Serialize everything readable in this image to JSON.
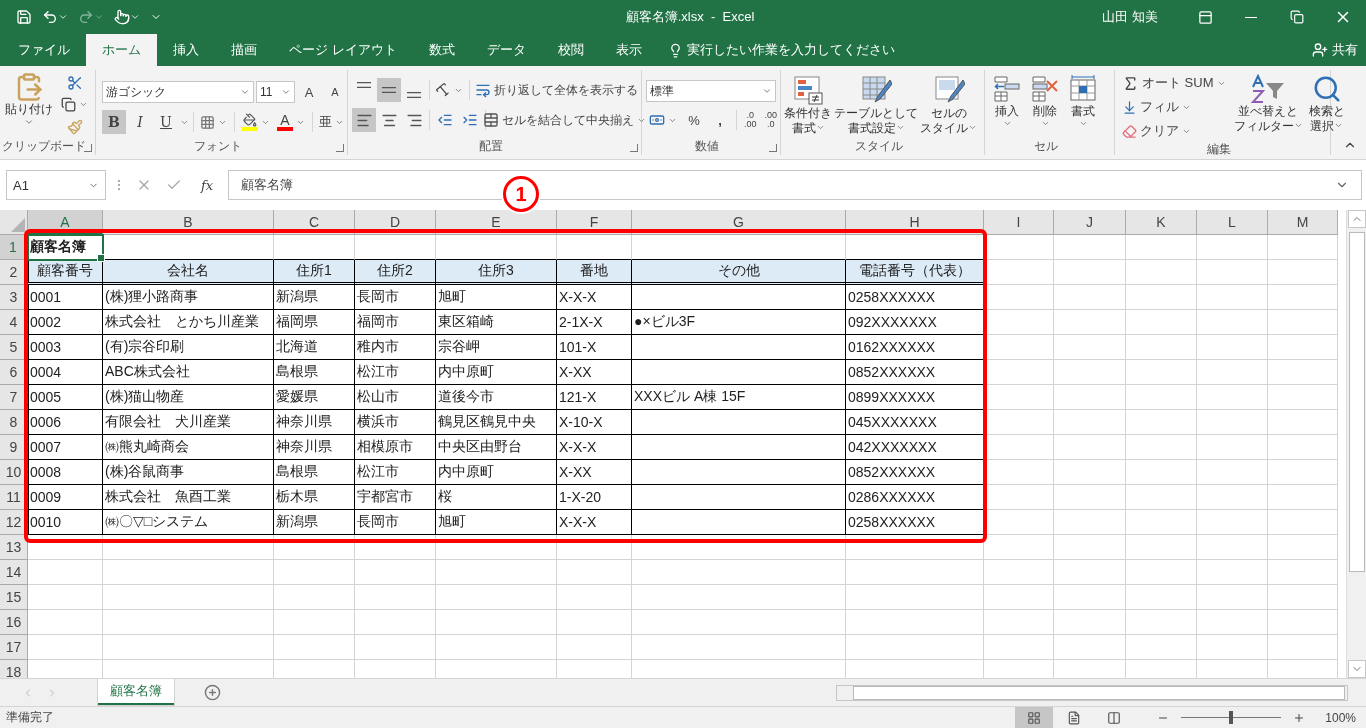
{
  "window": {
    "title": "顧客名簿.xlsx  -  Excel",
    "user": "山田 知美"
  },
  "tabs": [
    {
      "label": "ファイル",
      "selected": false
    },
    {
      "label": "ホーム",
      "selected": true
    },
    {
      "label": "挿入",
      "selected": false
    },
    {
      "label": "描画",
      "selected": false
    },
    {
      "label": "ページ レイアウト",
      "selected": false
    },
    {
      "label": "数式",
      "selected": false
    },
    {
      "label": "データ",
      "selected": false
    },
    {
      "label": "校閲",
      "selected": false
    },
    {
      "label": "表示",
      "selected": false
    }
  ],
  "tell_me": "実行したい作業を入力してください",
  "share": "共有",
  "clipboard": {
    "label": "クリップボード",
    "paste": "貼り付け"
  },
  "font": {
    "label": "フォント",
    "name": "游ゴシック",
    "size": "11",
    "grow": "A",
    "shrink": "A",
    "styles": [
      {
        "kind": "bold",
        "label": "B",
        "selected": true
      },
      {
        "kind": "italic",
        "label": "I",
        "selected": false
      },
      {
        "kind": "underline",
        "label": "U",
        "selected": false
      }
    ],
    "font_color_label": "A",
    "phonetic": "亜"
  },
  "alignment": {
    "label": "配置",
    "vertical": [
      {
        "kind": "top",
        "selected": false
      },
      {
        "kind": "middle",
        "selected": true
      },
      {
        "kind": "bottom",
        "selected": false
      }
    ],
    "horizontal": [
      {
        "kind": "left",
        "selected": true
      },
      {
        "kind": "center",
        "selected": false
      },
      {
        "kind": "right",
        "selected": false
      }
    ],
    "wrap": "折り返して全体を表示する",
    "merge": "セルを結合して中央揃え"
  },
  "number": {
    "label": "数値",
    "format": "標準",
    "percent": "%",
    "comma": ",",
    "decimals": [
      {
        "top": ".0",
        "bottom": ".00"
      },
      {
        "top": ".00",
        "bottom": ".0"
      }
    ]
  },
  "styles": {
    "label": "スタイル",
    "buttons": [
      "条件付き書式",
      "テーブルとして書式設定",
      "セルのスタイル"
    ]
  },
  "cells": {
    "label": "セル",
    "buttons": [
      "挿入",
      "削除",
      "書式"
    ]
  },
  "editing": {
    "label": "編集",
    "autosum": "オート SUM",
    "fill": "フィル",
    "clear": "クリア",
    "sort": "並べ替えとフィルター",
    "find": "検索と選択"
  },
  "formula_bar": {
    "name_box": "A1",
    "fx": "fx",
    "value": "顧客名簿"
  },
  "sheet": {
    "columns": [
      {
        "label": "A",
        "selected": true
      },
      {
        "label": "B",
        "selected": false
      },
      {
        "label": "C",
        "selected": false
      },
      {
        "label": "D",
        "selected": false
      },
      {
        "label": "E",
        "selected": false
      },
      {
        "label": "F",
        "selected": false
      },
      {
        "label": "G",
        "selected": false
      },
      {
        "label": "H",
        "selected": false
      },
      {
        "label": "I",
        "selected": false
      },
      {
        "label": "J",
        "selected": false
      },
      {
        "label": "K",
        "selected": false
      },
      {
        "label": "L",
        "selected": false
      },
      {
        "label": "M",
        "selected": false
      }
    ],
    "rows": [
      {
        "label": "1",
        "selected": true,
        "kind": "title",
        "cells": {
          "a": "顧客名簿"
        }
      },
      {
        "label": "2",
        "selected": false,
        "kind": "header",
        "cells": {
          "a": "顧客番号",
          "b": "会社名",
          "c": "住所1",
          "d": "住所2",
          "e": "住所3",
          "f": "番地",
          "g": "その他",
          "h": "電話番号（代表）"
        }
      },
      {
        "label": "3",
        "selected": false,
        "kind": "data",
        "cells": {
          "a": "0001",
          "b": "(株)狸小路商事",
          "c": "新潟県",
          "d": "長岡市",
          "e": "旭町",
          "f": "X-X-X",
          "h": "0258XXXXXX"
        }
      },
      {
        "label": "4",
        "selected": false,
        "kind": "data",
        "cells": {
          "a": "0002",
          "b": "株式会社　とかち川産業",
          "c": "福岡県",
          "d": "福岡市",
          "e": "東区箱崎",
          "f": "2-1X-X",
          "g": "●×ビル3F",
          "h": "092XXXXXXX"
        }
      },
      {
        "label": "5",
        "selected": false,
        "kind": "data",
        "cells": {
          "a": "0003",
          "b": "(有)宗谷印刷",
          "c": "北海道",
          "d": "稚内市",
          "e": "宗谷岬",
          "f": "101-X",
          "h": "0162XXXXXX"
        }
      },
      {
        "label": "6",
        "selected": false,
        "kind": "data",
        "cells": {
          "a": "0004",
          "b": "ABC株式会社",
          "c": "島根県",
          "d": "松江市",
          "e": "内中原町",
          "f": "X-XX",
          "h": "0852XXXXXX"
        }
      },
      {
        "label": "7",
        "selected": false,
        "kind": "data",
        "cells": {
          "a": "0005",
          "b": "(株)猫山物産",
          "c": "愛媛県",
          "d": "松山市",
          "e": "道後今市",
          "f": "121-X",
          "g": "XXXビル A棟 15F",
          "h": "0899XXXXXX"
        }
      },
      {
        "label": "8",
        "selected": false,
        "kind": "data",
        "cells": {
          "a": "0006",
          "b": "有限会社　犬川産業",
          "c": "神奈川県",
          "d": "横浜市",
          "e": "鶴見区鶴見中央",
          "f": "X-10-X",
          "h": "045XXXXXXX"
        }
      },
      {
        "label": "9",
        "selected": false,
        "kind": "data",
        "cells": {
          "a": "0007",
          "b": "㈱熊丸崎商会",
          "c": "神奈川県",
          "d": "相模原市",
          "e": "中央区由野台",
          "f": "X-X-X",
          "h": "042XXXXXXX"
        }
      },
      {
        "label": "10",
        "selected": false,
        "kind": "data",
        "cells": {
          "a": "0008",
          "b": "(株)谷鼠商事",
          "c": "島根県",
          "d": "松江市",
          "e": "内中原町",
          "f": "X-XX",
          "h": "0852XXXXXX"
        }
      },
      {
        "label": "11",
        "selected": false,
        "kind": "data",
        "cells": {
          "a": "0009",
          "b": "株式会社　魚酉工業",
          "c": "栃木県",
          "d": "宇都宮市",
          "e": "桜",
          "f": "1-X-20",
          "h": "0286XXXXXX"
        }
      },
      {
        "label": "12",
        "selected": false,
        "kind": "data",
        "cells": {
          "a": "0010",
          "b": "㈱〇▽□システム",
          "c": "新潟県",
          "d": "長岡市",
          "e": "旭町",
          "f": "X-X-X",
          "h": "0258XXXXXX"
        }
      },
      {
        "label": "13",
        "selected": false,
        "kind": "blank"
      },
      {
        "label": "14",
        "selected": false,
        "kind": "blank"
      },
      {
        "label": "15",
        "selected": false,
        "kind": "blank"
      },
      {
        "label": "16",
        "selected": false,
        "kind": "blank"
      },
      {
        "label": "17",
        "selected": false,
        "kind": "blank"
      },
      {
        "label": "18",
        "selected": false,
        "kind": "blank"
      }
    ]
  },
  "annotation": {
    "label": "1"
  },
  "sheet_tabs": [
    {
      "label": "顧客名簿",
      "selected": true
    }
  ],
  "status": {
    "text": "準備完了",
    "views": [
      {
        "kind": "normal",
        "selected": true
      },
      {
        "kind": "page_layout",
        "selected": false
      },
      {
        "kind": "page_break",
        "selected": false
      }
    ],
    "zoom": {
      "level": 0.5,
      "reading": "100%"
    }
  }
}
